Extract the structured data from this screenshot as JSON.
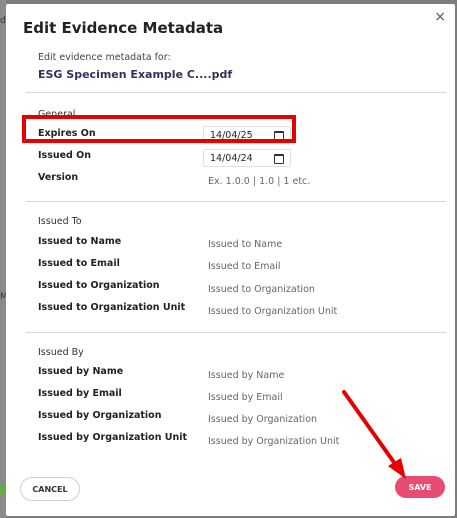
{
  "backdrop": {
    "fragments": [
      "di",
      "ME"
    ]
  },
  "dialog": {
    "title": "Edit Evidence Metadata",
    "subtitle": "Edit evidence metadata for:",
    "file_name": "ESG Specimen Example C....pdf",
    "close_glyph": "×"
  },
  "general": {
    "title": "General",
    "expires_on": {
      "label": "Expires On",
      "value": "14/04/25"
    },
    "issued_on": {
      "label": "Issued On",
      "value": "14/04/24"
    },
    "version": {
      "label": "Version",
      "placeholder": "Ex. 1.0.0 | 1.0 | 1 etc."
    }
  },
  "issued_to": {
    "title": "Issued To",
    "name": {
      "label": "Issued to Name",
      "placeholder": "Issued to Name"
    },
    "email": {
      "label": "Issued to Email",
      "placeholder": "Issued to Email"
    },
    "org": {
      "label": "Issued to Organization",
      "placeholder": "Issued to Organization"
    },
    "org_unit": {
      "label": "Issued to Organization Unit",
      "placeholder": "Issued to Organization Unit"
    }
  },
  "issued_by": {
    "title": "Issued By",
    "name": {
      "label": "Issued by Name",
      "placeholder": "Issued by Name"
    },
    "email": {
      "label": "Issued by Email",
      "placeholder": "Issued by Email"
    },
    "org": {
      "label": "Issued by Organization",
      "placeholder": "Issued by Organization"
    },
    "org_unit": {
      "label": "Issued by Organization Unit",
      "placeholder": "Issued by Organization Unit"
    }
  },
  "actions": {
    "cancel": "CANCEL",
    "save": "SAVE"
  },
  "colors": {
    "accent": "#e84c73",
    "highlight": "#e60000",
    "title": "#3b2d5e"
  }
}
